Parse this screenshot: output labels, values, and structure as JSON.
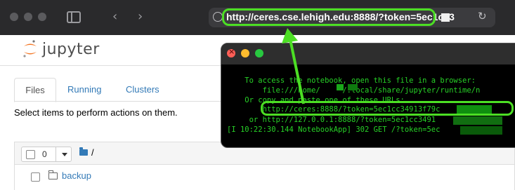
{
  "browser": {
    "url": "http://ceres.cse.lehigh.edu:8888/?token=5ec1cc3",
    "nav_back_icon": "chevron-left-icon",
    "nav_forward_icon": "chevron-right-icon"
  },
  "jupyter": {
    "logo_text": "jupyter",
    "tabs": [
      "Files",
      "Running",
      "Clusters"
    ],
    "instructions": "Select items to perform actions on them.",
    "selected_count": "0",
    "breadcrumb_path": "/",
    "files": [
      {
        "name": "backup",
        "type": "folder"
      }
    ]
  },
  "terminal": {
    "lines": [
      "    To access the notebook, open this file in a browser:",
      "        file:///home/     /.local/share/jupyter/runtime/n",
      "    Or copy and paste one of these URLs:",
      "        http://ceres:8888/?token=5ec1cc34913f79c",
      "     or http://127.0.0.1:8888/?token=5ec1cc3491",
      "[I 10:22:30.144 NotebookApp] 302 GET /?token=5ec"
    ]
  },
  "colors": {
    "highlight": "#4cdf24",
    "terminal_text": "#27d127",
    "link": "#337ab7"
  }
}
